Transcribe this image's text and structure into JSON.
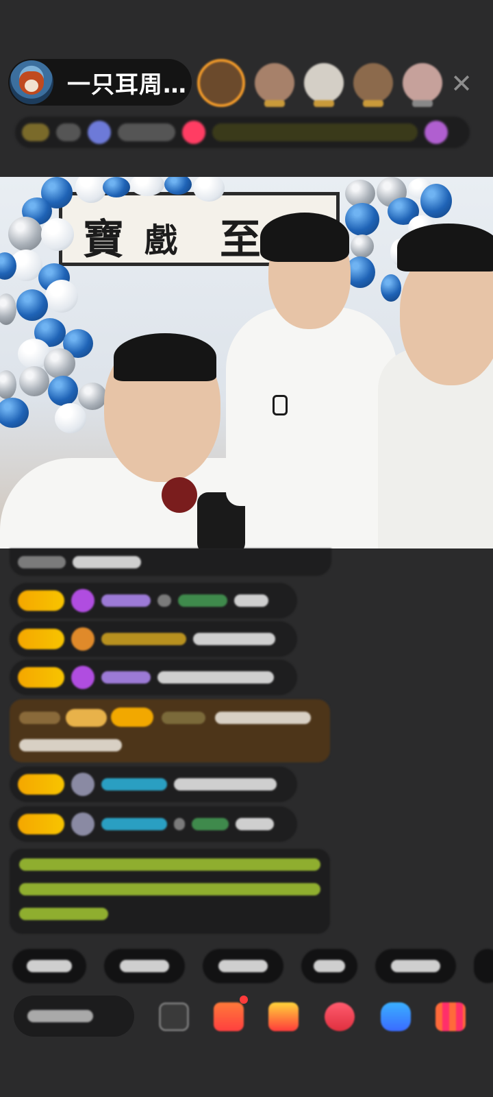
{
  "header": {
    "host_name": "一只耳周…",
    "close_label": "✕"
  },
  "colors": {
    "background": "#2b2b2c",
    "badge_gold": "#f5a700",
    "brown_card": "#4d3519",
    "first_avatar_ring": "#f19a2a"
  },
  "icons": {
    "close": "close-icon",
    "emoji": "emoji-icon",
    "gift_box": "gift-box-icon",
    "present": "present-icon",
    "heart": "heart-icon",
    "game": "gamepad-icon",
    "more": "grid-more-icon"
  }
}
